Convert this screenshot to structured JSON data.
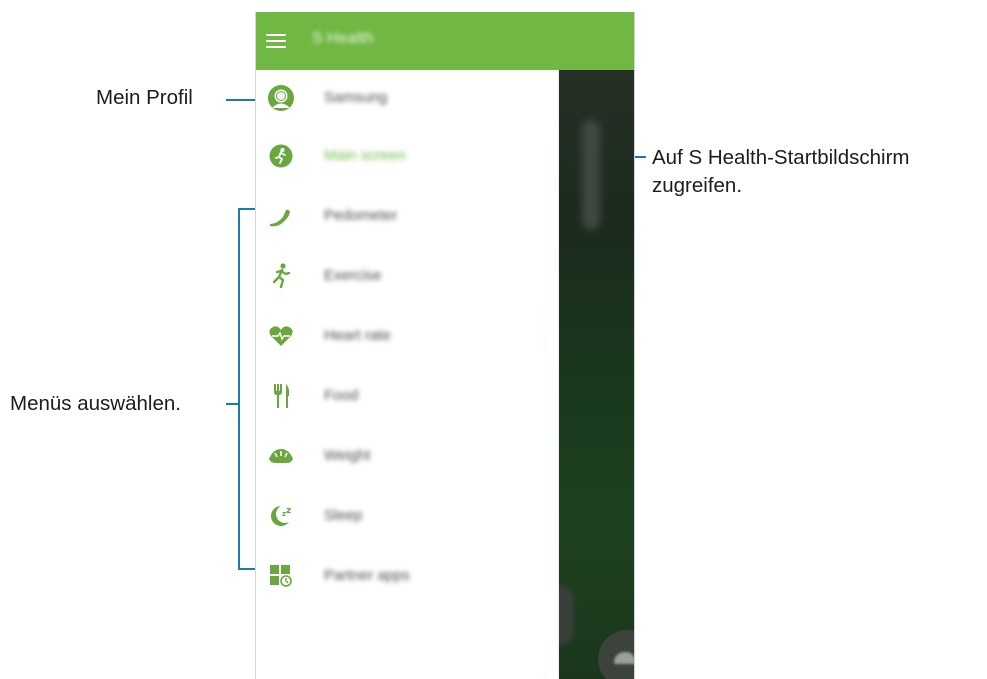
{
  "app": {
    "title": "S Health"
  },
  "menu": {
    "items": [
      {
        "id": "profile",
        "label": "Samsung",
        "icon": "profile-avatar-icon"
      },
      {
        "id": "main",
        "label": "Main screen",
        "icon": "running-circle-icon",
        "active": true
      },
      {
        "id": "pedometer",
        "label": "Pedometer",
        "icon": "shoe-icon"
      },
      {
        "id": "exercise",
        "label": "Exercise",
        "icon": "runner-icon"
      },
      {
        "id": "heart",
        "label": "Heart rate",
        "icon": "heart-pulse-icon"
      },
      {
        "id": "food",
        "label": "Food",
        "icon": "fork-knife-icon"
      },
      {
        "id": "weight",
        "label": "Weight",
        "icon": "scale-icon"
      },
      {
        "id": "sleep",
        "label": "Sleep",
        "icon": "moon-zz-icon"
      },
      {
        "id": "partner",
        "label": "Partner apps",
        "icon": "partner-grid-icon"
      }
    ]
  },
  "annotations": {
    "profile": "Mein Profil",
    "main_line1": "Auf S Health-Startbildschirm",
    "main_line2": "zugreifen.",
    "menus": "Menüs auswählen."
  },
  "colors": {
    "brand_green": "#70b743",
    "callout_blue": "#1f78b4",
    "icon_green": "#6aa83f"
  }
}
